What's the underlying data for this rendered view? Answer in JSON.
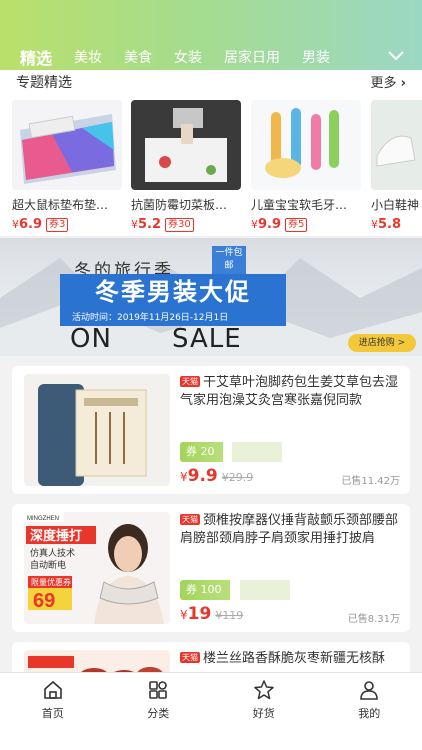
{
  "tabs": [
    "精选",
    "美妆",
    "美食",
    "女装",
    "居家日用",
    "男装"
  ],
  "section": {
    "title": "专题精选",
    "more": "更多"
  },
  "featured": [
    {
      "name": "超大鼠标垫布垫…",
      "price": "6.9",
      "coupon": "券3"
    },
    {
      "name": "抗菌防霉切菜板…",
      "price": "5.2",
      "coupon": "券30"
    },
    {
      "name": "儿童宝宝软毛牙…",
      "price": "9.9",
      "coupon": "券5"
    },
    {
      "name": "小白鞋神",
      "price": "5.8",
      "coupon": ""
    }
  ],
  "banner": {
    "small_title": "冬的旅行季",
    "badge": "一件包邮",
    "main": "冬季男装大促",
    "date": "活动时间：2019年11月26日-12月1日",
    "on": "ON",
    "sale": "SALE",
    "button": "进店抢购 >"
  },
  "products": [
    {
      "badge": "天猫",
      "title": "干艾草叶泡脚药包生姜艾草包去湿气家用泡澡艾灸宫寒张嘉倪同款",
      "coupon": "券 20",
      "price": "9.9",
      "old_price": "29.9",
      "sold": "已售11.42万",
      "image_text": "草本调理"
    },
    {
      "badge": "天猫",
      "title": "颈椎按摩器仪捶背敲颤乐颈部腰部肩膀部颈肩脖子肩颈家用捶打披肩",
      "coupon": "券 100",
      "price": "19",
      "old_price": "119",
      "sold": "已售8.31万",
      "image_text": {
        "brand": "MINGZHEN",
        "headline": "深度捶打",
        "line1": "仿真人技术",
        "line2": "自动断电",
        "limit": "限量优惠券",
        "limit_price": "69"
      }
    },
    {
      "badge": "天猫",
      "title": "楼兰丝路香酥脆灰枣新疆无核酥"
    }
  ],
  "nav": [
    {
      "label": "首页",
      "icon": "home-icon"
    },
    {
      "label": "分类",
      "icon": "category-icon"
    },
    {
      "label": "好货",
      "icon": "star-icon"
    },
    {
      "label": "我的",
      "icon": "user-icon"
    }
  ],
  "colors": {
    "accent": "#e8362b",
    "header_start": "#b9e06a",
    "header_end": "#9bd8c4",
    "coupon_green": "#a4d45b",
    "banner_blue": "#2b73d1"
  }
}
